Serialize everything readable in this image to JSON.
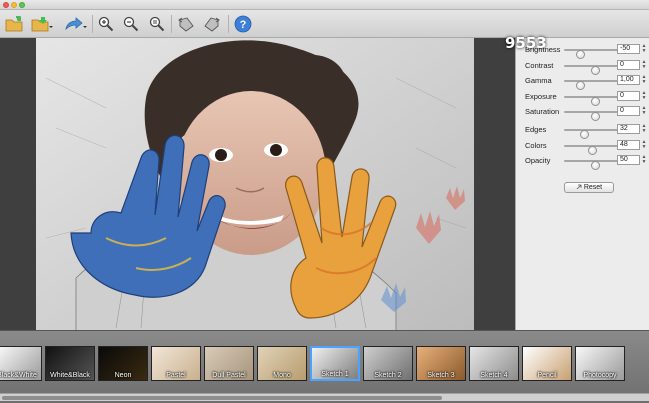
{
  "toolbar": {
    "buttons": [
      {
        "name": "open-image-button",
        "icon": "folder-open-icon"
      },
      {
        "name": "save-image-button",
        "icon": "folder-save-icon"
      },
      {
        "name": "share-button",
        "icon": "share-icon"
      },
      {
        "name": "zoom-in-button",
        "icon": "zoom-in-icon"
      },
      {
        "name": "zoom-out-button",
        "icon": "zoom-out-icon"
      },
      {
        "name": "zoom-fit-button",
        "icon": "zoom-fit-icon"
      },
      {
        "name": "rotate-left-button",
        "icon": "rotate-left-icon"
      },
      {
        "name": "rotate-right-button",
        "icon": "rotate-right-icon"
      },
      {
        "name": "help-button",
        "icon": "help-icon"
      }
    ]
  },
  "adjustments": {
    "brightness": {
      "label": "Brightness",
      "value": "-50",
      "level": 0.25
    },
    "contrast": {
      "label": "Contrast",
      "value": "0",
      "level": 0.5
    },
    "gamma": {
      "label": "Gamma",
      "value": "1,00",
      "level": 0.25
    },
    "exposure": {
      "label": "Exposure",
      "value": "0",
      "level": 0.5
    },
    "saturation": {
      "label": "Saturation",
      "value": "0",
      "level": 0.5
    },
    "edges": {
      "label": "Edges",
      "value": "32",
      "level": 0.32
    },
    "colors": {
      "label": "Colors",
      "value": "48",
      "level": 0.45
    },
    "opacity": {
      "label": "Opacity",
      "value": "50",
      "level": 0.5
    },
    "reset_label": "Reset"
  },
  "filmstrip": {
    "selected": "Sketch 1",
    "presets": [
      "Black&White",
      "White&Black",
      "Neon",
      "Pastel",
      "Dull Pastel",
      "Mono",
      "Sketch 1",
      "Sketch 2",
      "Sketch 3",
      "Sketch 4",
      "Pencil",
      "Photocopy"
    ]
  },
  "watermark": "9553",
  "colors": {
    "accent": "#4aa3ff",
    "panel_bg": "#ececec",
    "canvas_bg": "#3f3f3f"
  }
}
